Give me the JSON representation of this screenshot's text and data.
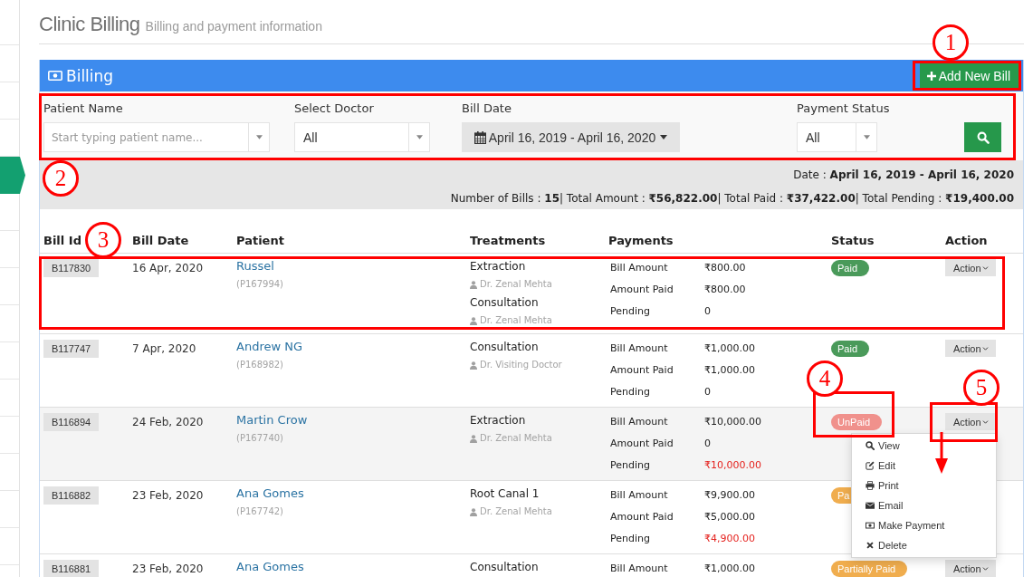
{
  "sidebar": {
    "items": [
      {
        "selected": false
      },
      {
        "selected": false
      },
      {
        "selected": false
      },
      {
        "selected": false
      },
      {
        "selected": true
      },
      {
        "selected": false
      },
      {
        "selected": false
      },
      {
        "selected": false
      },
      {
        "selected": false
      },
      {
        "selected": false
      },
      {
        "selected": false
      },
      {
        "selected": false
      },
      {
        "selected": false
      },
      {
        "selected": false
      },
      {
        "selected": false
      }
    ]
  },
  "header": {
    "title": "Clinic Billing",
    "subtitle": "Billing and payment information"
  },
  "panel": {
    "title": "Billing",
    "add_button": "Add New Bill"
  },
  "filters": [
    {
      "kind": "autocomplete",
      "label": "Patient Name",
      "placeholder": "Start typing patient name..."
    },
    {
      "kind": "select",
      "label": "Select Doctor",
      "value": "All"
    },
    {
      "kind": "daterange",
      "label": "Bill Date",
      "value": "April 16, 2019 - April 16, 2020"
    },
    {
      "kind": "select",
      "label": "Payment Status",
      "value": "All"
    }
  ],
  "summary": {
    "date_line": "Date : **April 16, 2019 - April 16, 2020**",
    "totals_line": "Number of Bills : **15**| Total Amount : **₹56,822.00**| Total Paid : **₹37,422.00**| Total Pending : **₹19,400.00**"
  },
  "table": {
    "columns": [
      "Bill Id",
      "Bill Date",
      "Patient",
      "Treatments",
      "Payments",
      "Status",
      "Action"
    ],
    "rows": [
      {
        "bill_id": "B117830",
        "date": "16 Apr, 2020",
        "patient": "Russel",
        "patient_id": "(P167994)",
        "treatments": [
          {
            "name": "Extraction",
            "doctor": "Dr. Zenal Mehta"
          },
          {
            "name": "Consultation",
            "doctor": "Dr. Zenal Mehta"
          }
        ],
        "payments": [
          {
            "label": "Bill Amount",
            "value": "₹800.00",
            "alert": false
          },
          {
            "label": "Amount Paid",
            "value": "₹800.00",
            "alert": false
          },
          {
            "label": "Pending",
            "value": "0",
            "alert": false
          }
        ],
        "status": {
          "label": "Paid",
          "color": "#4a9a5a"
        },
        "action": "Action",
        "hovered": false,
        "menu_open": false
      },
      {
        "bill_id": "B117747",
        "date": "7 Apr, 2020",
        "patient": "Andrew NG",
        "patient_id": "(P168982)",
        "treatments": [
          {
            "name": "Consultation",
            "doctor": "Dr. Visiting Doctor"
          }
        ],
        "payments": [
          {
            "label": "Bill Amount",
            "value": "₹1,000.00",
            "alert": false
          },
          {
            "label": "Amount Paid",
            "value": "₹1,000.00",
            "alert": false
          },
          {
            "label": "Pending",
            "value": "0",
            "alert": false
          }
        ],
        "status": {
          "label": "Paid",
          "color": "#4a9a5a"
        },
        "action": "Action",
        "hovered": false,
        "menu_open": false
      },
      {
        "bill_id": "B116894",
        "date": "24 Feb, 2020",
        "patient": "Martin Crow",
        "patient_id": "(P167740)",
        "treatments": [
          {
            "name": "Extraction",
            "doctor": "Dr. Zenal Mehta"
          }
        ],
        "payments": [
          {
            "label": "Bill Amount",
            "value": "₹10,000.00",
            "alert": false
          },
          {
            "label": "Amount Paid",
            "value": "0",
            "alert": false
          },
          {
            "label": "Pending",
            "value": "₹10,000.00",
            "alert": true
          }
        ],
        "status": {
          "label": "UnPaid",
          "color": "#f0918c"
        },
        "action": "Action",
        "hovered": true,
        "menu_open": true
      },
      {
        "bill_id": "B116882",
        "date": "23 Feb, 2020",
        "patient": "Ana Gomes",
        "patient_id": "(P167742)",
        "treatments": [
          {
            "name": "Root Canal 1",
            "doctor": "Dr. Zenal Mehta"
          }
        ],
        "payments": [
          {
            "label": "Bill Amount",
            "value": "₹9,900.00",
            "alert": false
          },
          {
            "label": "Amount Paid",
            "value": "₹5,000.00",
            "alert": false
          },
          {
            "label": "Pending",
            "value": "₹4,900.00",
            "alert": true
          }
        ],
        "status": {
          "label": "Pa",
          "color": "#f0ad4e"
        },
        "hovered": false,
        "menu_open": false
      },
      {
        "bill_id": "B116881",
        "date": "23 Feb, 2020",
        "patient": "Ana Gomes",
        "treatments": [
          {
            "name": "Consultation"
          }
        ],
        "payments": [
          {
            "label": "Bill Amount",
            "value": "₹1,000.00",
            "alert": false
          }
        ],
        "status": {
          "label": "Partially Paid",
          "color": "#f0ad4e"
        },
        "action": "Action",
        "hovered": false,
        "menu_open": false
      }
    ]
  },
  "action_menu": {
    "items": [
      "View",
      "Edit",
      "Print",
      "Email",
      "Make Payment",
      "Delete"
    ]
  },
  "annotations": [
    {
      "number": "1"
    },
    {
      "number": "2"
    },
    {
      "number": "3"
    },
    {
      "number": "4"
    },
    {
      "number": "5"
    }
  ]
}
